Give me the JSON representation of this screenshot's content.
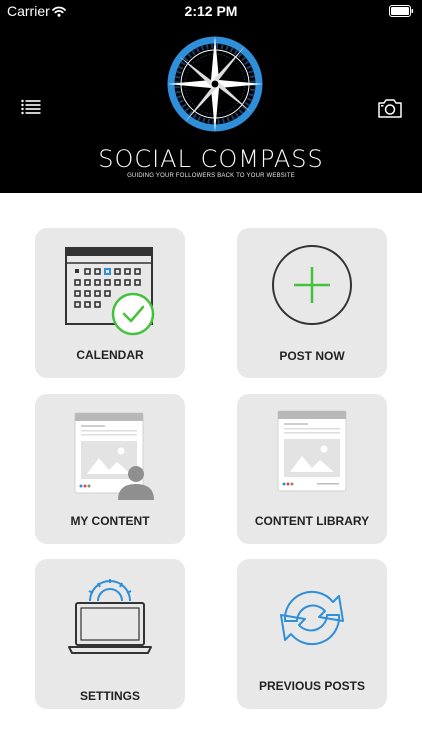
{
  "status_bar": {
    "carrier": "Carrier",
    "time": "2:12 PM",
    "wifi_icon": "wifi-icon",
    "battery_icon": "battery-icon"
  },
  "header": {
    "menu_icon": "list-menu-icon",
    "camera_icon": "camera-icon",
    "logo_icon": "compass-logo-icon",
    "brand": "SOCIAL COMPASS",
    "tagline": "GUIDING YOUR FOLLOWERS BACK TO YOUR WEBSITE"
  },
  "colors": {
    "header_bg": "#000000",
    "tile_bg": "#e8e8e8",
    "accent_blue": "#2f8fd8",
    "accent_green": "#44c23c",
    "label": "#222222"
  },
  "tiles": [
    {
      "label": "CALENDAR",
      "icon": "calendar-check-icon"
    },
    {
      "label": "POST NOW",
      "icon": "plus-circle-icon"
    },
    {
      "label": "MY CONTENT",
      "icon": "user-content-icon"
    },
    {
      "label": "CONTENT LIBRARY",
      "icon": "content-library-icon"
    },
    {
      "label": "SETTINGS",
      "icon": "laptop-gear-icon"
    },
    {
      "label": "PREVIOUS POSTS",
      "icon": "refresh-arrows-icon"
    }
  ]
}
